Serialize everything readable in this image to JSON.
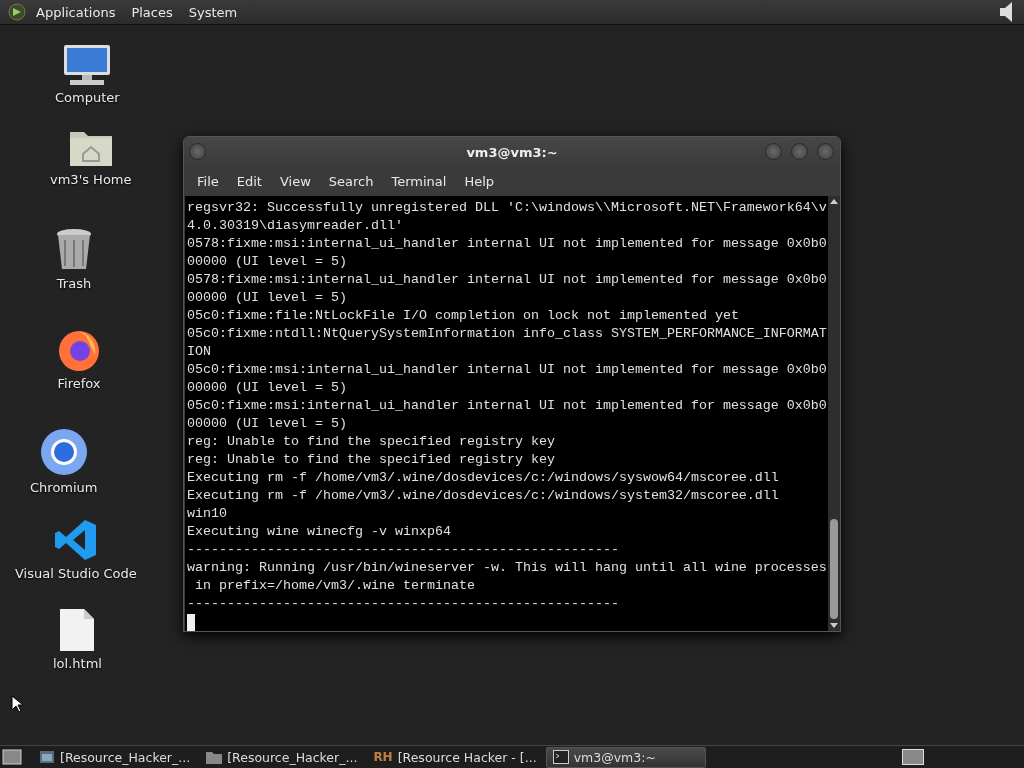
{
  "top_panel": {
    "menus": [
      "Applications",
      "Places",
      "System"
    ]
  },
  "desktop_icons": [
    {
      "kind": "computer",
      "label": "Computer"
    },
    {
      "kind": "home",
      "label": "vm3's Home"
    },
    {
      "kind": "trash",
      "label": "Trash"
    },
    {
      "kind": "firefox",
      "label": "Firefox"
    },
    {
      "kind": "chromium",
      "label": "Chromium"
    },
    {
      "kind": "vscode",
      "label": "Visual Studio Code"
    },
    {
      "kind": "file",
      "label": "lol.html"
    }
  ],
  "window": {
    "title": "vm3@vm3:~",
    "menus": [
      "File",
      "Edit",
      "View",
      "Search",
      "Terminal",
      "Help"
    ],
    "lines": [
      "regsvr32: Successfully unregistered DLL 'C:\\windows\\\\Microsoft.NET\\Framework64\\v",
      "4.0.30319\\diasymreader.dll'",
      "0578:fixme:msi:internal_ui_handler internal UI not implemented for message 0x0b0",
      "00000 (UI level = 5)",
      "0578:fixme:msi:internal_ui_handler internal UI not implemented for message 0x0b0",
      "00000 (UI level = 5)",
      "05c0:fixme:file:NtLockFile I/O completion on lock not implemented yet",
      "05c0:fixme:ntdll:NtQuerySystemInformation info_class SYSTEM_PERFORMANCE_INFORMAT",
      "ION",
      "05c0:fixme:msi:internal_ui_handler internal UI not implemented for message 0x0b0",
      "00000 (UI level = 5)",
      "05c0:fixme:msi:internal_ui_handler internal UI not implemented for message 0x0b0",
      "00000 (UI level = 5)",
      "reg: Unable to find the specified registry key",
      "reg: Unable to find the specified registry key",
      "Executing rm -f /home/vm3/.wine/dosdevices/c:/windows/syswow64/mscoree.dll",
      "Executing rm -f /home/vm3/.wine/dosdevices/c:/windows/system32/mscoree.dll",
      "win10",
      "Executing wine winecfg -v winxp64",
      "------------------------------------------------------",
      "warning: Running /usr/bin/wineserver -w. This will hang until all wine processes",
      " in prefix=/home/vm3/.wine terminate",
      "------------------------------------------------------"
    ]
  },
  "taskbar": {
    "items": [
      {
        "kind": "app",
        "label": "[Resource_Hacker_...",
        "selected": false
      },
      {
        "kind": "folder",
        "label": "[Resource_Hacker_...",
        "selected": false
      },
      {
        "kind": "rh",
        "icon_text": "RH",
        "label": "[Resource Hacker - [...",
        "selected": false
      },
      {
        "kind": "terminal",
        "label": "vm3@vm3:~",
        "selected": true
      }
    ]
  }
}
